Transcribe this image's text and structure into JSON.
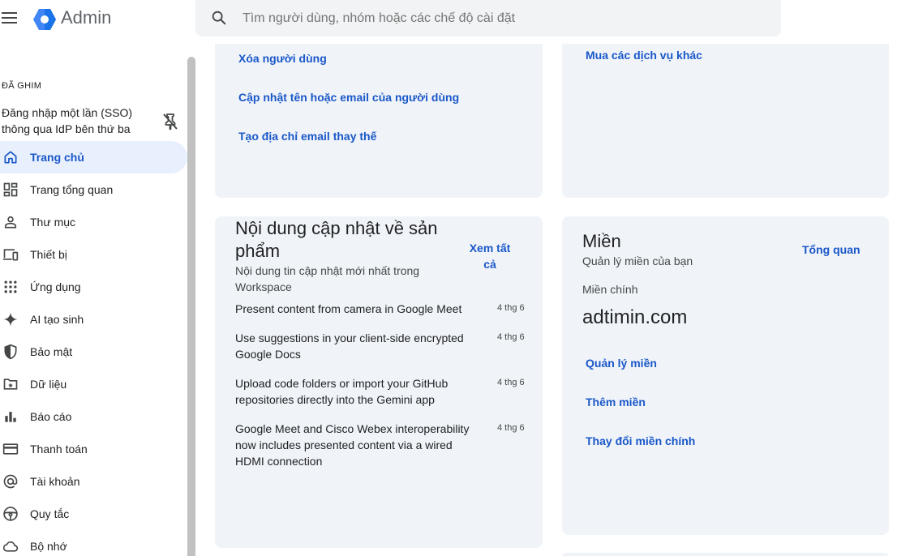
{
  "header": {
    "app_title": "Admin",
    "search_placeholder": "Tìm người dùng, nhóm hoặc các chế độ cài đặt"
  },
  "sidebar": {
    "pinned_title": "ĐÃ GHIM",
    "pinned_item_line1": "Đăng nhập một lần (SSO)",
    "pinned_item_line2": "thông qua IdP bên thứ ba",
    "items": [
      {
        "label": "Trang chủ",
        "icon": "home-icon",
        "active": true
      },
      {
        "label": "Trang tổng quan",
        "icon": "dashboard-icon"
      },
      {
        "label": "Thư mục",
        "icon": "person-icon"
      },
      {
        "label": "Thiết bị",
        "icon": "devices-icon"
      },
      {
        "label": "Ứng dụng",
        "icon": "apps-grid-icon"
      },
      {
        "label": "AI tạo sinh",
        "icon": "sparkle-icon"
      },
      {
        "label": "Bảo mật",
        "icon": "shield-icon"
      },
      {
        "label": "Dữ liệu",
        "icon": "folder-data-icon"
      },
      {
        "label": "Báo cáo",
        "icon": "bar-chart-icon"
      },
      {
        "label": "Thanh toán",
        "icon": "credit-card-icon"
      },
      {
        "label": "Tài khoản",
        "icon": "at-sign-icon"
      },
      {
        "label": "Quy tắc",
        "icon": "steering-wheel-icon"
      },
      {
        "label": "Bộ nhớ",
        "icon": "cloud-icon"
      }
    ]
  },
  "user_card": {
    "links": [
      "Xóa người dùng",
      "Cập nhật tên hoặc email của người dùng",
      "Tạo địa chỉ email thay thế"
    ]
  },
  "billing_card": {
    "link": "Mua các dịch vụ khác"
  },
  "updates_card": {
    "title_line1": "Nội dung cập nhật về sản",
    "title_line2": "phẩm",
    "subtitle_line1": "Nội dung tin cập nhật mới nhất trong",
    "subtitle_line2": "Workspace",
    "see_all_line1": "Xem tất",
    "see_all_line2": "cả",
    "items": [
      {
        "lines": [
          "Present content from camera in Google Meet"
        ],
        "date": "4 thg 6"
      },
      {
        "lines": [
          "Use suggestions in your client-side encrypted",
          "Google Docs"
        ],
        "date": "4 thg 6"
      },
      {
        "lines": [
          "Upload code folders or import your GitHub",
          "repositories directly into the Gemini app"
        ],
        "date": "4 thg 6"
      },
      {
        "lines": [
          "Google Meet and Cisco Webex interoperability",
          "now includes presented content via a wired",
          "HDMI connection"
        ],
        "date": "4 thg 6"
      }
    ]
  },
  "domains_card": {
    "title": "Miền",
    "subtitle": "Quản lý miền của bạn",
    "overview_link": "Tổng quan",
    "primary_label": "Miền chính",
    "primary_domain": "adtimin.com",
    "links": [
      "Quản lý miền",
      "Thêm miền",
      "Thay đổi miền chính"
    ]
  },
  "colors": {
    "accent": "#1a57c8",
    "active_bg": "#e8f0fe",
    "card_bg": "#f0f4f9"
  }
}
